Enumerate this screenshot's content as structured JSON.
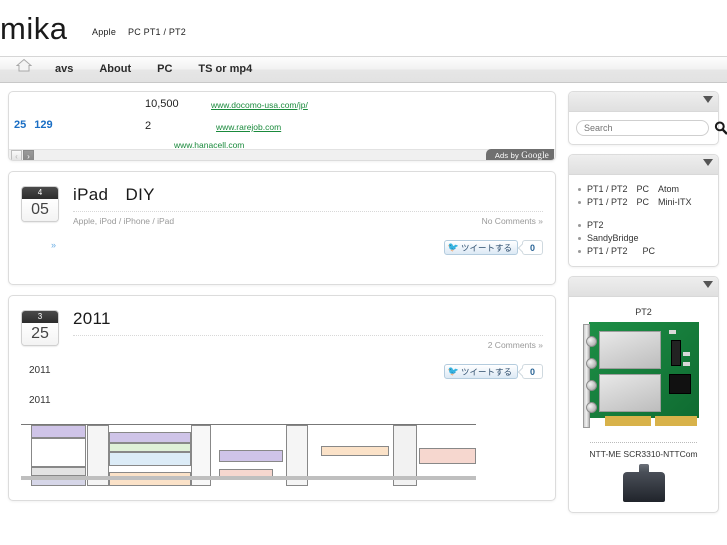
{
  "header": {
    "site_title": "mika",
    "tagline_segments": [
      "Apple",
      "PC PT1 / PT2"
    ]
  },
  "nav": {
    "home_icon": "home-icon",
    "items": [
      {
        "label": "avs"
      },
      {
        "label": "About"
      },
      {
        "label": "PC"
      },
      {
        "label": "TS or mp4"
      }
    ]
  },
  "ad_block": {
    "price_1": "10,500",
    "price_2": "2",
    "numbers": [
      "25",
      "129"
    ],
    "urls": [
      "www.docomo-usa.com/jp/",
      "www.rarejob.com",
      "www.hanacell.com"
    ],
    "prev_label": "‹",
    "next_label": "›",
    "ads_by": "Ads by",
    "ads_by_brand": "Google"
  },
  "posts": [
    {
      "month": "4",
      "day": "05",
      "title": "iPad　DIY",
      "categories": "Apple, iPod / iPhone / iPad",
      "comments": "No Comments »",
      "tweet_label": "ツイートする",
      "tweet_count": "0",
      "paragraphs": [],
      "readmore": "»"
    },
    {
      "month": "3",
      "day": "25",
      "title": "2011",
      "categories": "",
      "comments": "2 Comments »",
      "tweet_label": "ツイートする",
      "tweet_count": "0",
      "paragraphs": [
        "2011",
        "2011"
      ],
      "readmore": ""
    }
  ],
  "sidebar": {
    "search": {
      "placeholder": "Search",
      "value": "",
      "icon": "search-icon"
    },
    "links": [
      {
        "segments": [
          "PT1 / PT2",
          "PC",
          "Atom"
        ]
      },
      {
        "segments": [
          "PT1 / PT2",
          "PC",
          "Mini-ITX"
        ]
      },
      {
        "spacer": true
      },
      {
        "segments": [
          "PT2"
        ]
      },
      {
        "segments": [
          "SandyBridge"
        ]
      },
      {
        "segments": [
          "PT1 / PT2",
          "PC"
        ]
      }
    ],
    "products": [
      {
        "name": "PT2",
        "image": "pci-tuner-card-image"
      },
      {
        "name": "NTT-ME SCR3310-NTTCom",
        "image": "card-reader-image"
      }
    ],
    "toggle_icon": "chevron-down-icon"
  },
  "colors": {
    "link_green": "#1a8a3c",
    "link_blue": "#1a6ec4",
    "accent": "#6aade4",
    "pcb_green": "#18843f"
  }
}
